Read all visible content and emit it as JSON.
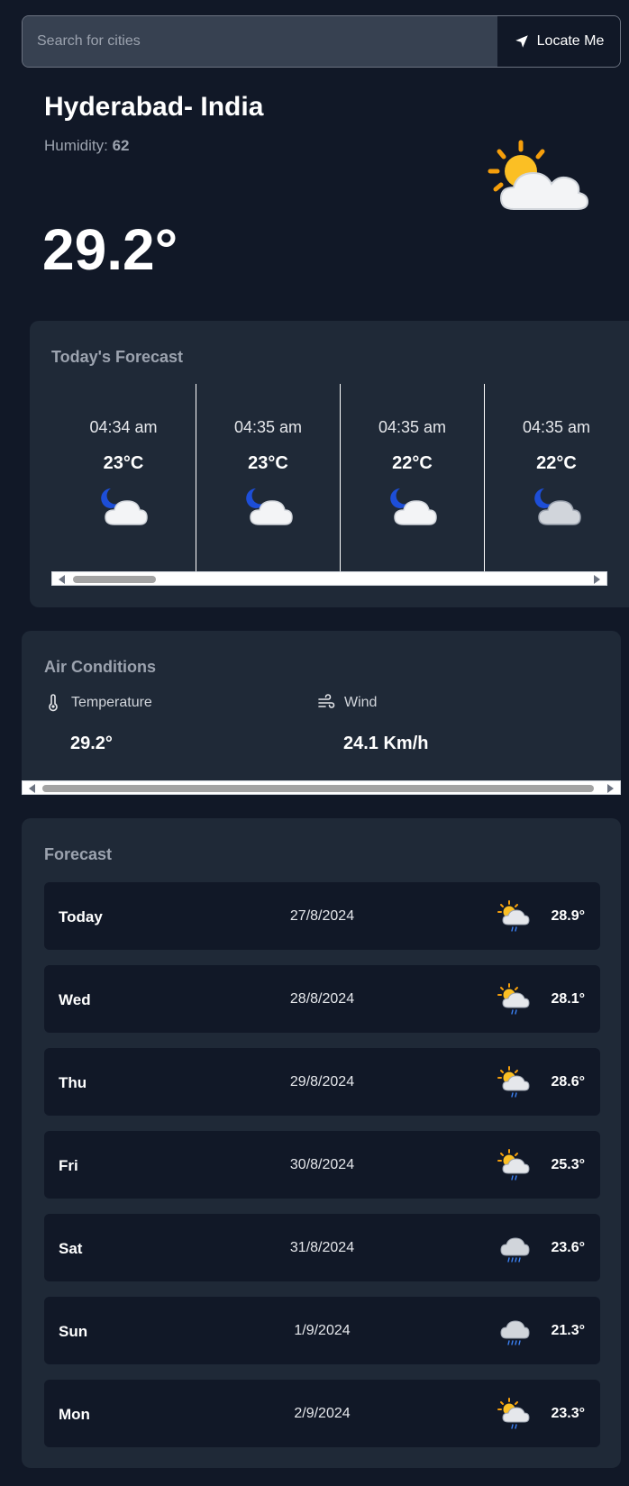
{
  "search": {
    "placeholder": "Search for cities",
    "locate_label": "Locate Me"
  },
  "current": {
    "city": "Hyderabad- India",
    "humidity_label": "Humidity:",
    "humidity_value": "62",
    "temperature": "29.2°",
    "icon": "partly-cloudy-sun-icon"
  },
  "today": {
    "title": "Today's Forecast",
    "hours": [
      {
        "time": "04:34 am",
        "temp": "23°C",
        "icon": "night-cloud-icon"
      },
      {
        "time": "04:35 am",
        "temp": "23°C",
        "icon": "night-cloud-icon"
      },
      {
        "time": "04:35 am",
        "temp": "22°C",
        "icon": "night-cloud-icon"
      },
      {
        "time": "04:35 am",
        "temp": "22°C",
        "icon": "night-cloud-icon"
      }
    ]
  },
  "air": {
    "title": "Air Conditions",
    "temperature_label": "Temperature",
    "temperature_value": "29.2°",
    "wind_label": "Wind",
    "wind_value": "24.1 Km/h"
  },
  "forecast": {
    "title": "Forecast",
    "days": [
      {
        "day": "Today",
        "date": "27/8/2024",
        "temp": "28.9°",
        "icon": "sun-cloud-rain-icon"
      },
      {
        "day": "Wed",
        "date": "28/8/2024",
        "temp": "28.1°",
        "icon": "sun-cloud-rain-icon"
      },
      {
        "day": "Thu",
        "date": "29/8/2024",
        "temp": "28.6°",
        "icon": "sun-cloud-rain-icon"
      },
      {
        "day": "Fri",
        "date": "30/8/2024",
        "temp": "25.3°",
        "icon": "sun-cloud-rain-icon"
      },
      {
        "day": "Sat",
        "date": "31/8/2024",
        "temp": "23.6°",
        "icon": "cloud-rain-icon"
      },
      {
        "day": "Sun",
        "date": "1/9/2024",
        "temp": "21.3°",
        "icon": "cloud-rain-icon"
      },
      {
        "day": "Mon",
        "date": "2/9/2024",
        "temp": "23.3°",
        "icon": "sun-cloud-rain-icon"
      }
    ]
  },
  "colors": {
    "background": "#111827",
    "panel": "#1f2937",
    "muted": "#9ca3af"
  }
}
